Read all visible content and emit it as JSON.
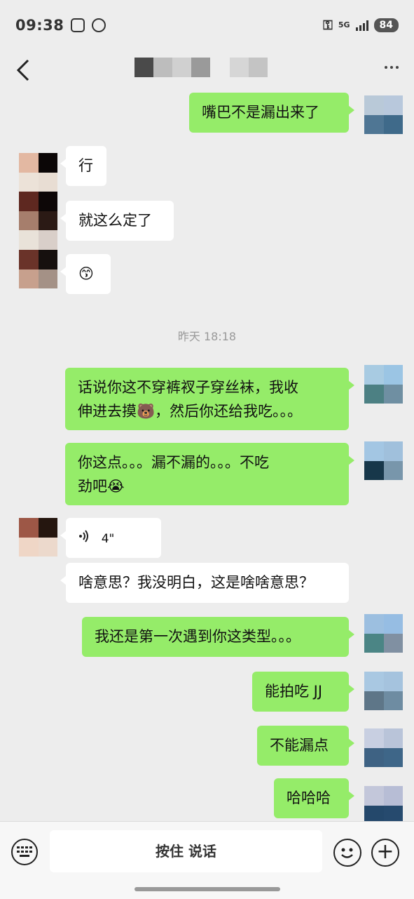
{
  "status_bar": {
    "time": "09:38",
    "network_label": "5G",
    "battery": "84"
  },
  "chat": {
    "messages": [
      {
        "side": "me",
        "text": "嘴巴不是漏出来了"
      },
      {
        "side": "them",
        "text": "行"
      },
      {
        "side": "them",
        "text": "就这么定了"
      },
      {
        "side": "them",
        "text": "😙"
      },
      {
        "side": "me",
        "text_line1": "话说你这不穿裤衩子穿丝袜，我收",
        "text_line2": "伸进去摸🐻，然后你还给我吃。。。"
      },
      {
        "side": "me",
        "text_line1": "你这点。。。漏不漏的。。。不吃",
        "text_line2": "劲吧😭"
      },
      {
        "side": "them",
        "type": "voice",
        "duration": "4\""
      },
      {
        "side": "them",
        "text": "啥意思？我没明白，这是啥啥意思？"
      },
      {
        "side": "me",
        "text": "我还是第一次遇到你这类型。。。"
      },
      {
        "side": "me",
        "text": "能拍吃 JJ"
      },
      {
        "side": "me",
        "text": "不能漏点"
      },
      {
        "side": "me",
        "text": "哈哈哈"
      }
    ],
    "timestamp": "昨天 18:18"
  },
  "input_bar": {
    "hold_to_talk_label": "按住 说话"
  },
  "colors": {
    "my_bubble": "#95ec69",
    "their_bubble": "#ffffff",
    "background": "#ededed"
  }
}
